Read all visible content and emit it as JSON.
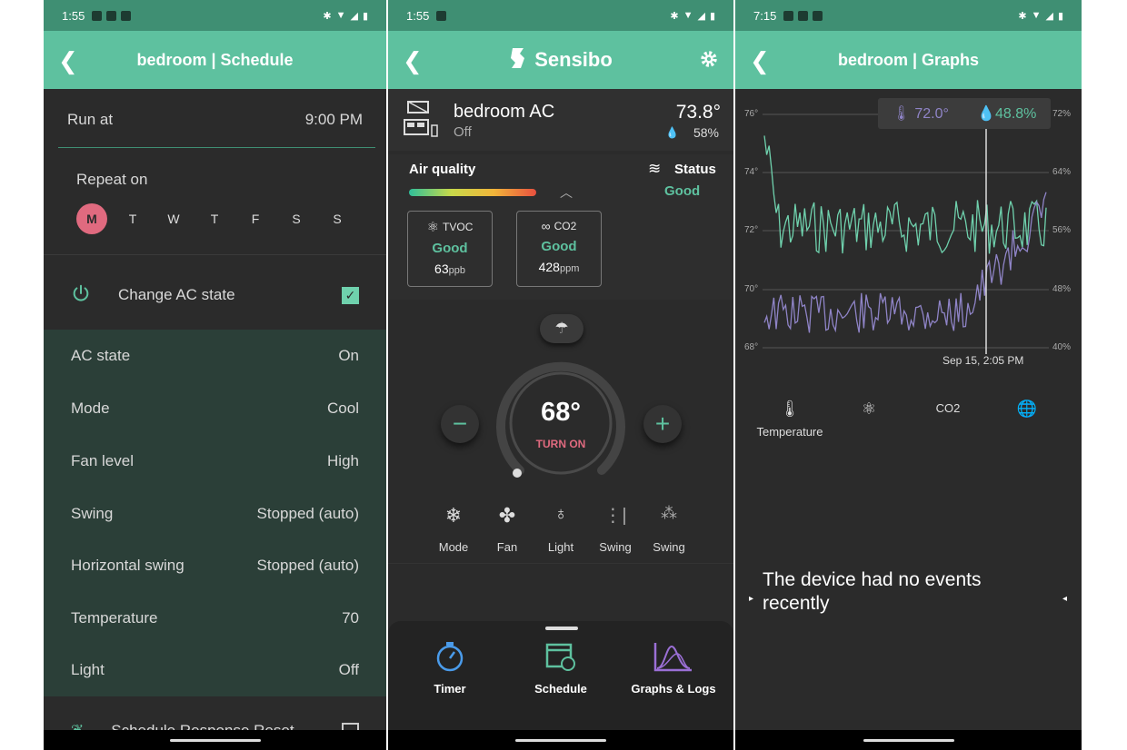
{
  "status": {
    "left_time": "1:55",
    "mid_time": "1:55",
    "right_time": "7:15"
  },
  "schedule": {
    "title": "bedroom | Schedule",
    "run_at_label": "Run at",
    "run_at_value": "9:00 PM",
    "repeat_label": "Repeat on",
    "days": [
      "M",
      "T",
      "W",
      "T",
      "F",
      "S",
      "S"
    ],
    "change_state_label": "Change AC state",
    "rows": [
      {
        "label": "AC state",
        "value": "On"
      },
      {
        "label": "Mode",
        "value": "Cool"
      },
      {
        "label": "Fan level",
        "value": "High"
      },
      {
        "label": "Swing",
        "value": "Stopped (auto)"
      },
      {
        "label": "Horizontal swing",
        "value": "Stopped (auto)"
      },
      {
        "label": "Temperature",
        "value": "70"
      },
      {
        "label": "Light",
        "value": "Off"
      }
    ],
    "partial_label": "Schedule Response Reset"
  },
  "main": {
    "brand": "Sensibo",
    "device_name": "bedroom AC",
    "device_state": "Off",
    "room_temp": "73.8°",
    "room_humidity": "58%",
    "aq_label": "Air quality",
    "status_label": "Status",
    "status_value": "Good",
    "tvoc": {
      "label": "TVOC",
      "state": "Good",
      "value": "63",
      "unit": "ppb"
    },
    "co2": {
      "label": "CO2",
      "state": "Good",
      "value": "428",
      "unit": "ppm"
    },
    "target_temp": "68°",
    "turn_on_label": "TURN ON",
    "minus": "−",
    "plus": "+",
    "modes": [
      "Mode",
      "Fan",
      "Light",
      "Swing",
      "Swing"
    ],
    "tabs": [
      "Timer",
      "Schedule",
      "Graphs & Logs"
    ]
  },
  "graphs": {
    "title": "bedroom | Graphs",
    "tooltip_temp": "72.0°",
    "tooltip_hum": "48.8%",
    "left_axis": [
      "76°",
      "74°",
      "72°",
      "70°",
      "68°"
    ],
    "right_axis": [
      "72%",
      "64%",
      "56%",
      "48%",
      "40%"
    ],
    "cursor_label": "Sep 15, 2:05 PM",
    "temperature_tab": "Temperature",
    "co2_tab": "CO2",
    "no_events": "The device had no events recently"
  },
  "colors": {
    "accent": "#5ec19f",
    "status_bar": "#3f8f73",
    "selected_day": "#e06a7f",
    "temp_line": "#8f84c7"
  }
}
